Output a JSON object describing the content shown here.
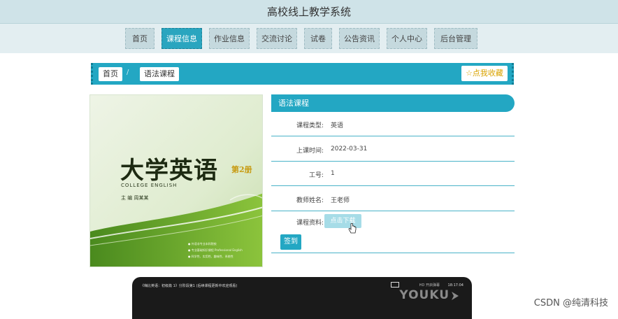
{
  "site": {
    "title": "高校线上教学系统"
  },
  "nav": {
    "items": [
      {
        "label": "首页"
      },
      {
        "label": "课程信息"
      },
      {
        "label": "作业信息"
      },
      {
        "label": "交流讨论"
      },
      {
        "label": "试卷"
      },
      {
        "label": "公告资讯"
      },
      {
        "label": "个人中心"
      },
      {
        "label": "后台管理"
      }
    ],
    "active_index": 1
  },
  "breadcrumb": {
    "home": "首页",
    "separator": "/",
    "current": "语法课程"
  },
  "favorite_button": "☆点我收藏",
  "cover": {
    "title": "大学英语",
    "volume": "第2册",
    "subtitle": "COLLEGE ENGLISH",
    "editor": "主 编  周某某",
    "bullets": [
      "● 外语非专业本科院校",
      "● 专业基础知识课程 Professional English",
      "● 科学性、实用性、趣味性、系统性"
    ]
  },
  "course": {
    "name": "语法课程",
    "fields": [
      {
        "label": "课程类型:",
        "value": "英语"
      },
      {
        "label": "上课时间:",
        "value": "2022-03-31"
      },
      {
        "label": "工号:",
        "value": "1"
      },
      {
        "label": "教师姓名:",
        "value": "王老师"
      },
      {
        "label": "课程资料:",
        "value": ""
      }
    ],
    "download_label": "点击下载",
    "sign_label": "签到"
  },
  "video": {
    "title": "《嗨比英语：初级篇 1》分阶段第1 (后续课程更新中欢迎观看)",
    "tag": "HD 开启弹幕",
    "time": "18:17:04",
    "brand": "YOUKU"
  },
  "watermark": "CSDN @纯清科技"
}
